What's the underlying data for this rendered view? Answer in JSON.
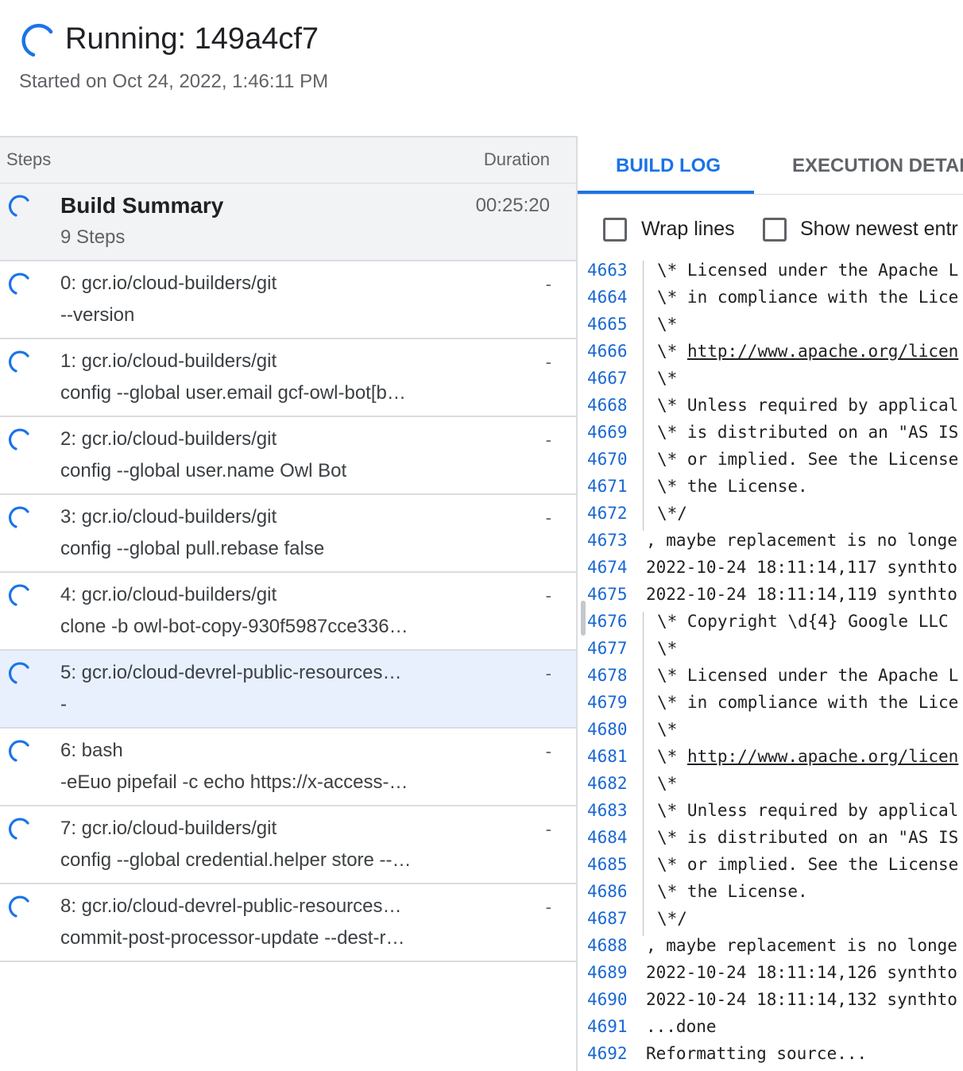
{
  "header": {
    "title": "Running: 149a4cf7",
    "subtitle": "Started on Oct 24, 2022, 1:46:11 PM"
  },
  "steps_panel": {
    "col_steps": "Steps",
    "col_duration": "Duration",
    "summary": {
      "name": "Build Summary",
      "count": "9 Steps",
      "duration": "00:25:20"
    },
    "steps": [
      {
        "line1": "0: gcr.io/cloud-builders/git",
        "line2": "--version",
        "duration": "-"
      },
      {
        "line1": "1: gcr.io/cloud-builders/git",
        "line2": "config --global user.email gcf-owl-bot[b…",
        "duration": "-"
      },
      {
        "line1": "2: gcr.io/cloud-builders/git",
        "line2": "config --global user.name Owl Bot",
        "duration": "-"
      },
      {
        "line1": "3: gcr.io/cloud-builders/git",
        "line2": "config --global pull.rebase false",
        "duration": "-"
      },
      {
        "line1": "4: gcr.io/cloud-builders/git",
        "line2": "clone -b owl-bot-copy-930f5987cce336…",
        "duration": "-"
      },
      {
        "line1": "5: gcr.io/cloud-devrel-public-resources…",
        "line2": "-",
        "duration": "-"
      },
      {
        "line1": "6: bash",
        "line2": "-eEuo pipefail -c echo https://x-access-…",
        "duration": "-"
      },
      {
        "line1": "7: gcr.io/cloud-builders/git",
        "line2": "config --global credential.helper store --…",
        "duration": "-"
      },
      {
        "line1": "8: gcr.io/cloud-devrel-public-resources…",
        "line2": "commit-post-processor-update --dest-r…",
        "duration": "-"
      }
    ]
  },
  "log_panel": {
    "tabs": [
      "BUILD LOG",
      "EXECUTION DETAI"
    ],
    "wrap_lines_label": "Wrap lines",
    "show_newest_label": "Show newest entr",
    "lines": [
      {
        "n": "4663",
        "t": "\\* Licensed under the Apache L"
      },
      {
        "n": "4664",
        "t": "\\* in compliance with the Lice"
      },
      {
        "n": "4665",
        "t": "\\*"
      },
      {
        "n": "4666",
        "t": "\\* http://www.apache.org/licen"
      },
      {
        "n": "4667",
        "t": "\\*"
      },
      {
        "n": "4668",
        "t": "\\* Unless required by applical"
      },
      {
        "n": "4669",
        "t": "\\* is distributed on an \"AS IS"
      },
      {
        "n": "4670",
        "t": "\\* or implied. See the License"
      },
      {
        "n": "4671",
        "t": "\\* the License."
      },
      {
        "n": "4672",
        "t": "\\*/"
      },
      {
        "n": "4673",
        "t": ", maybe replacement is no longe"
      },
      {
        "n": "4674",
        "t": "2022-10-24 18:11:14,117 synthto"
      },
      {
        "n": "4675",
        "t": "2022-10-24 18:11:14,119 synthto"
      },
      {
        "n": "4676",
        "t": "\\* Copyright \\d{4} Google LLC"
      },
      {
        "n": "4677",
        "t": "\\*"
      },
      {
        "n": "4678",
        "t": "\\* Licensed under the Apache L"
      },
      {
        "n": "4679",
        "t": "\\* in compliance with the Lice"
      },
      {
        "n": "4680",
        "t": "\\*"
      },
      {
        "n": "4681",
        "t": "\\* http://www.apache.org/licen"
      },
      {
        "n": "4682",
        "t": "\\*"
      },
      {
        "n": "4683",
        "t": "\\* Unless required by applical"
      },
      {
        "n": "4684",
        "t": "\\* is distributed on an \"AS IS"
      },
      {
        "n": "4685",
        "t": "\\* or implied. See the License"
      },
      {
        "n": "4686",
        "t": "\\* the License."
      },
      {
        "n": "4687",
        "t": "\\*/"
      },
      {
        "n": "4688",
        "t": ", maybe replacement is no longe"
      },
      {
        "n": "4689",
        "t": "2022-10-24 18:11:14,126 synthto"
      },
      {
        "n": "4690",
        "t": "2022-10-24 18:11:14,132 synthto"
      },
      {
        "n": "4691",
        "t": "...done"
      },
      {
        "n": "4692",
        "t": "Reformatting source..."
      }
    ]
  },
  "colors": {
    "accent": "#1a73e8",
    "selected_row": "#e8f0fe",
    "header_bg": "#f1f3f4",
    "line_number": "#1967d2"
  },
  "icons": {
    "status": "spinner-icon"
  }
}
